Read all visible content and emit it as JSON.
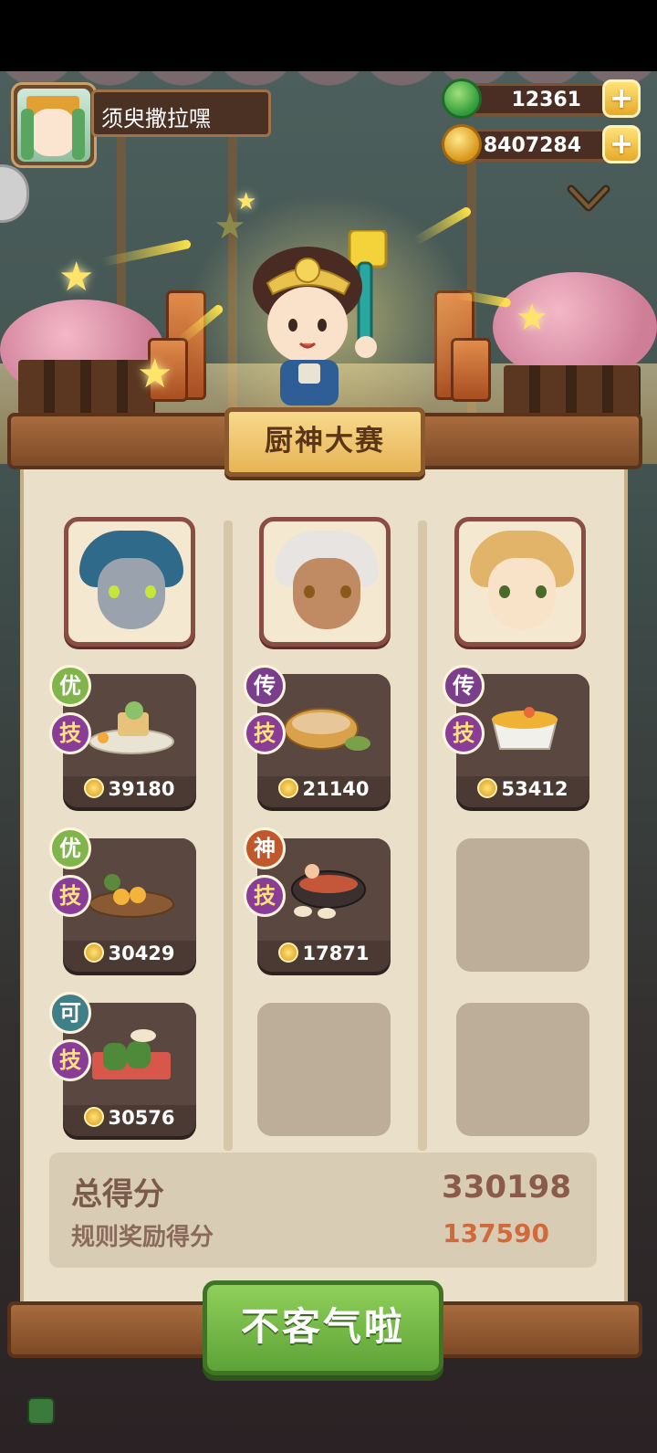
{
  "player": {
    "name": "须臾撒拉嘿"
  },
  "currency": {
    "jade": {
      "value": "12361",
      "icon": "jade-coin-icon",
      "plus": "+"
    },
    "gold": {
      "value": "8407284",
      "icon": "gold-coin-icon",
      "plus": "+"
    }
  },
  "event": {
    "title": "厨神大赛"
  },
  "columns": [
    {
      "portrait": "wolf-chef-portrait",
      "dishes": [
        {
          "grade": "优",
          "skill": "技",
          "score": "39180"
        },
        {
          "grade": "优",
          "skill": "技",
          "score": "30429"
        },
        {
          "grade": "可",
          "skill": "技",
          "score": "30576"
        }
      ]
    },
    {
      "portrait": "white-hair-chef-portrait",
      "dishes": [
        {
          "grade": "传",
          "skill": "技",
          "score": "21140"
        },
        {
          "grade": "神",
          "skill": "技",
          "score": "17871"
        }
      ]
    },
    {
      "portrait": "crowned-chef-portrait",
      "dishes": [
        {
          "grade": "传",
          "skill": "技",
          "score": "53412"
        }
      ]
    }
  ],
  "summary": {
    "total_label": "总得分",
    "total_value": "330198",
    "bonus_label": "规则奖励得分",
    "bonus_value": "137590"
  },
  "confirm_button": "不客气啦",
  "colors": {
    "accent_green": "#6cb43f",
    "panel": "#eadfc8",
    "wood": "#8a5a2d",
    "bonus": "#d06a3c"
  }
}
